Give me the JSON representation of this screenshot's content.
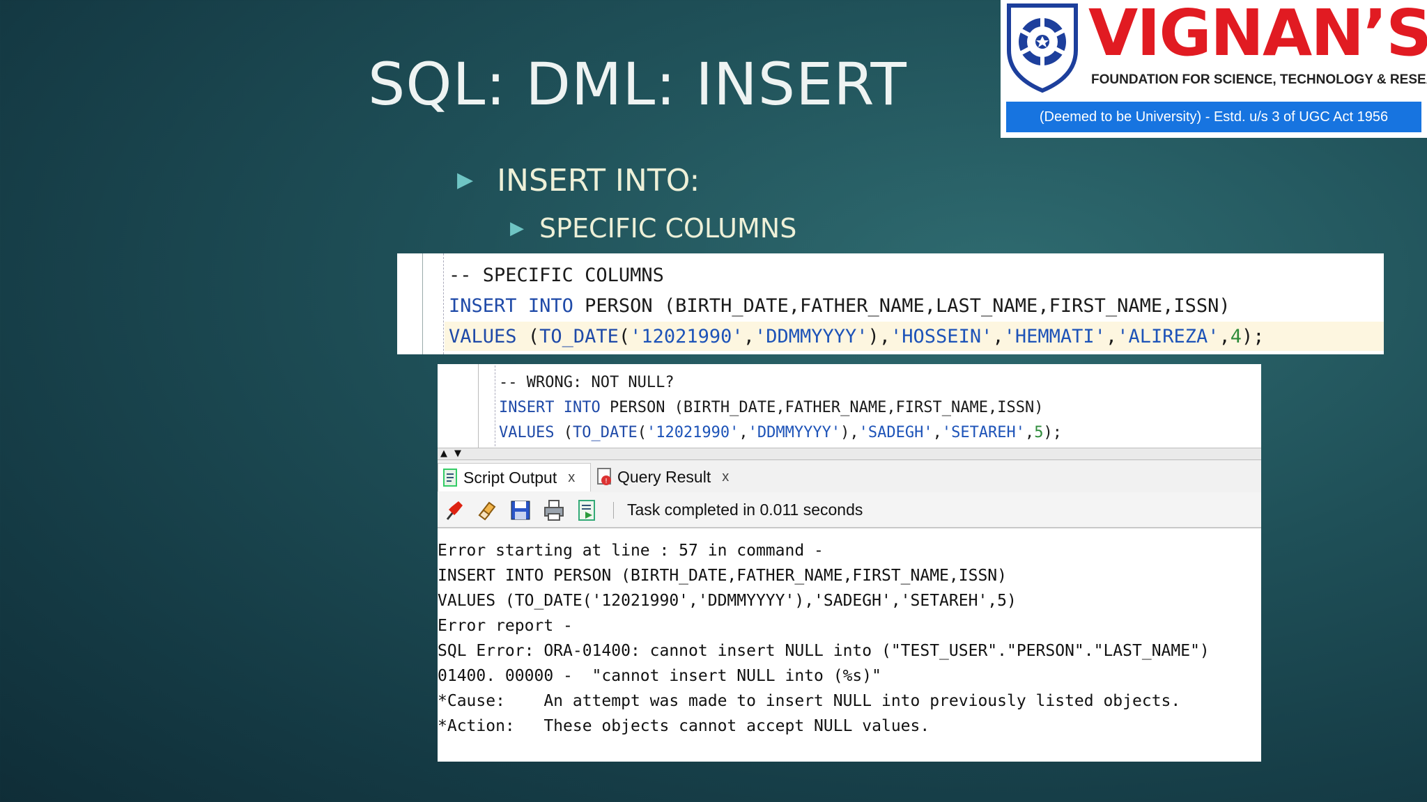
{
  "slide": {
    "title": "SQL: DML: INSERT",
    "bullet1": "INSERT INTO:",
    "bullet2": "SPECIFIC COLUMNS"
  },
  "logo": {
    "brand": "VIGNAN’S",
    "tagline": "FOUNDATION FOR SCIENCE, TECHNOLOGY & RESEARCH",
    "subtitle": "(Deemed to be University) - Estd. u/s 3 of UGC Act 1956"
  },
  "code_top": {
    "comment": "-- SPECIFIC COLUMNS",
    "kw_insert": "INSERT",
    "kw_into": "INTO",
    "insert_rest": " PERSON (BIRTH_DATE,FATHER_NAME,LAST_NAME,FIRST_NAME,ISSN)",
    "kw_values": "VALUES",
    "open": " (",
    "fn": "TO_DATE",
    "args_open": "(",
    "s1": "'12021990'",
    "s2": "'DDMMYYYY'",
    "s3": "'HOSSEIN'",
    "s4": "'HEMMATI'",
    "s5": "'ALIREZA'",
    "n1": "4",
    "comma": ",",
    "close_paren": "),",
    "end": ");"
  },
  "code_bottom": {
    "comment": "-- WRONG: NOT NULL?",
    "kw_insert": "INSERT",
    "kw_into": "INTO",
    "insert_rest": " PERSON (BIRTH_DATE,FATHER_NAME,FIRST_NAME,ISSN)",
    "kw_values": "VALUES",
    "open": " (",
    "fn": "TO_DATE",
    "args_open": "(",
    "s1": "'12021990'",
    "s2": "'DDMMYYYY'",
    "s3": "'SADEGH'",
    "s4": "'SETAREH'",
    "n1": "5",
    "comma": ",",
    "close_paren": "),",
    "end": ");"
  },
  "output": {
    "tabs": [
      {
        "label": "Script Output",
        "close": "x",
        "icon": "script-output-icon"
      },
      {
        "label": "Query Result",
        "close": "x",
        "icon": "query-result-icon"
      }
    ],
    "toolbar_icons": [
      "pin-icon",
      "eraser-icon",
      "save-icon",
      "print-icon",
      "run-script-icon"
    ],
    "status": "Task completed in 0.011 seconds",
    "lines": [
      "Error starting at line : 57 in command -",
      "INSERT INTO PERSON (BIRTH_DATE,FATHER_NAME,FIRST_NAME,ISSN)",
      "VALUES (TO_DATE('12021990','DDMMYYYY'),'SADEGH','SETAREH',5)",
      "Error report -",
      "SQL Error: ORA-01400: cannot insert NULL into (\"TEST_USER\".\"PERSON\".\"LAST_NAME\")",
      "01400. 00000 -  \"cannot insert NULL into (%s)\"",
      "*Cause:    An attempt was made to insert NULL into previously listed objects.",
      "*Action:   These objects cannot accept NULL values."
    ]
  },
  "colors": {
    "background": "#1f5058",
    "brand_red": "#e11b22",
    "brand_blue": "#1774e0",
    "keyword": "#1f4aa8",
    "number": "#2e8b3a"
  }
}
